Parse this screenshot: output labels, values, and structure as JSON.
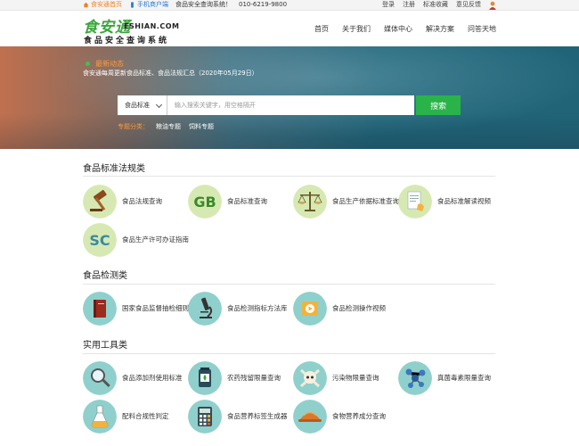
{
  "topbar": {
    "home": "食安通首页",
    "mobile": "手机商户端",
    "system": "食品安全查询系统！",
    "phone": "010-6219-9800",
    "login": "登录",
    "register": "注册",
    "favorites": "标准收藏",
    "feedback": "意见反馈"
  },
  "logo": {
    "cn": "食安通",
    "en": "ESHIAN.COM",
    "sub": "食品安全查询系统"
  },
  "nav": [
    "首页",
    "关于我们",
    "媒体中心",
    "解决方案",
    "问答天地"
  ],
  "banner": {
    "news_title": "最新动态",
    "news_text": "食安通每周更新食品标准、食品法规汇总（2020年05月29日）",
    "search_select": "食品标准",
    "search_placeholder": "输入搜索关键字，用空格隔开",
    "search_button": "搜索",
    "topics_label": "专题分类：",
    "topics": [
      "粮油专题",
      "饲料专题"
    ]
  },
  "sections": [
    {
      "title": "食品标准法规类",
      "items": [
        {
          "label": "食品法规查询",
          "icon": "gavel-icon"
        },
        {
          "label": "食品标准查询",
          "icon": "gb-icon"
        },
        {
          "label": "食品生产依据标准查询",
          "icon": "scale-icon"
        },
        {
          "label": "食品标准解读视频",
          "icon": "document-hand-icon"
        },
        {
          "label": "食品生产许可办证指南",
          "icon": "sc-icon"
        }
      ]
    },
    {
      "title": "食品检测类",
      "items": [
        {
          "label": "国家食品监督抽检细则",
          "icon": "book-icon"
        },
        {
          "label": "食品检测指标方法库",
          "icon": "microscope-icon"
        },
        {
          "label": "食品检测操作视频",
          "icon": "play-icon"
        }
      ]
    },
    {
      "title": "实用工具类",
      "items": [
        {
          "label": "食品添加剂使用标准",
          "icon": "magnifier-icon"
        },
        {
          "label": "农药残留限量查询",
          "icon": "pesticide-icon"
        },
        {
          "label": "污染物限量查询",
          "icon": "skull-icon"
        },
        {
          "label": "真菌毒素限量查询",
          "icon": "molecule-icon"
        },
        {
          "label": "配料合规性判定",
          "icon": "flask-icon"
        },
        {
          "label": "食品营养标签生成器",
          "icon": "calculator-icon"
        },
        {
          "label": "食物营养成分查询",
          "icon": "food-dish-icon"
        }
      ]
    }
  ],
  "colors": {
    "brand_green": "#29b34a",
    "accent_orange": "#ff9a3a",
    "icon_circle": "#d6e9b3"
  }
}
